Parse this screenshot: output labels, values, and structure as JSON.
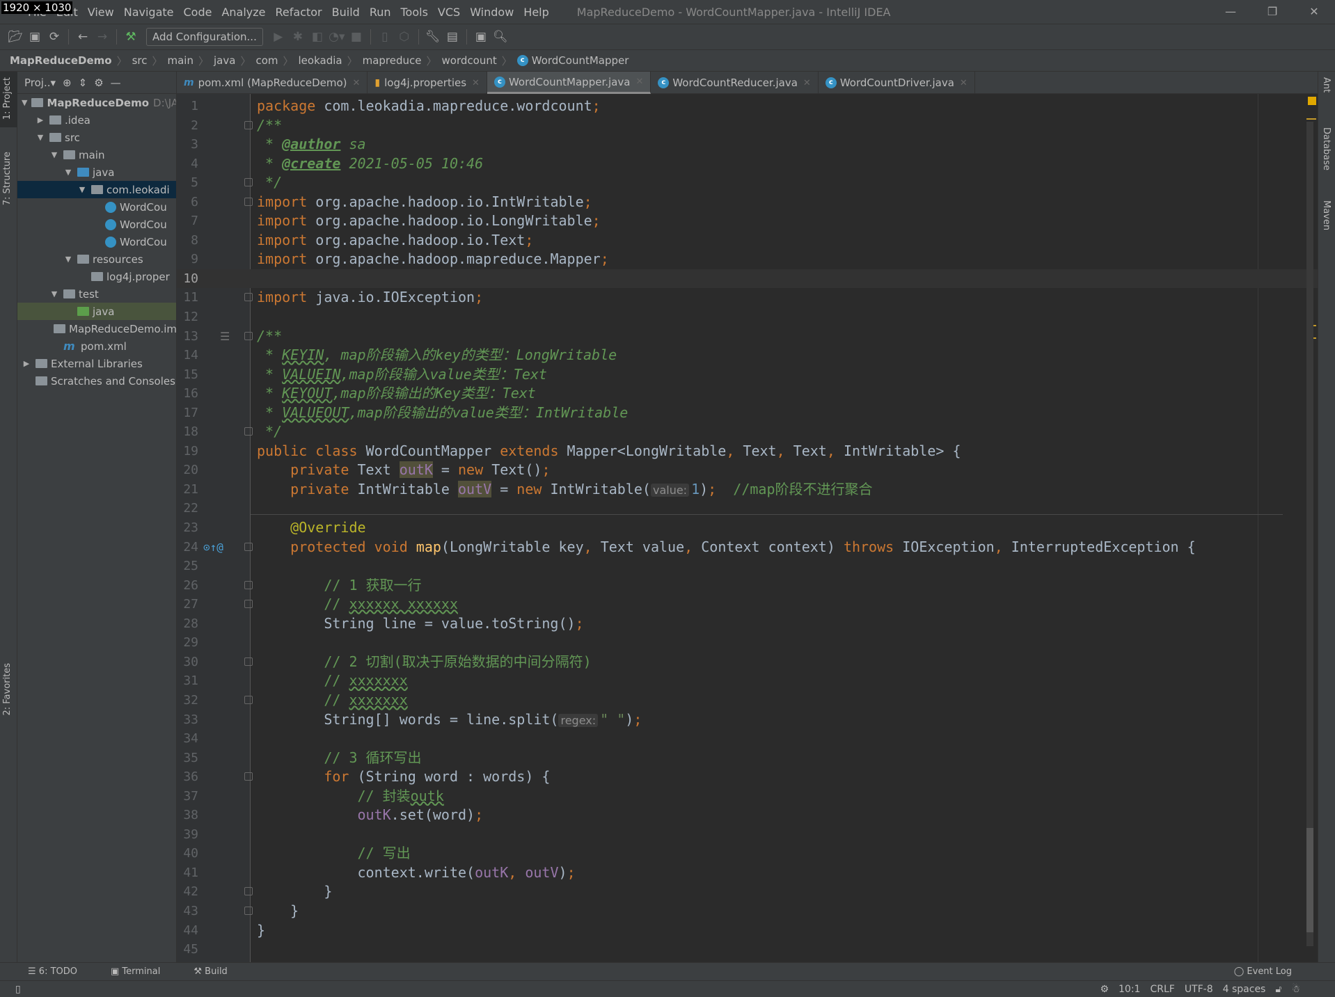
{
  "window": {
    "title": "MapReduceDemo - WordCountMapper.java - IntelliJ IDEA",
    "size_overlay": "1920 × 1030"
  },
  "menu": [
    "File",
    "Edit",
    "View",
    "Navigate",
    "Code",
    "Analyze",
    "Refactor",
    "Build",
    "Run",
    "Tools",
    "VCS",
    "Window",
    "Help"
  ],
  "toolbar": {
    "add_configuration": "Add Configuration..."
  },
  "breadcrumb": [
    "MapReduceDemo",
    "src",
    "main",
    "java",
    "com",
    "leokadia",
    "mapreduce",
    "wordcount",
    "WordCountMapper"
  ],
  "left_strip": {
    "project": "1: Project",
    "structure": "7: Structure",
    "favorites": "2: Favorites"
  },
  "right_strip": {
    "ant": "Ant",
    "database": "Database",
    "maven": "Maven"
  },
  "project": {
    "header": "Proj..▾",
    "tree": [
      {
        "label": "MapReduceDemo",
        "extra": "D:\\JA",
        "level": 0,
        "arrow": "▼",
        "icon": "module",
        "bold": true
      },
      {
        "label": ".idea",
        "level": 1,
        "arrow": "▶",
        "icon": "folder"
      },
      {
        "label": "src",
        "level": 1,
        "arrow": "▼",
        "icon": "folder"
      },
      {
        "label": "main",
        "level": 2,
        "arrow": "▼",
        "icon": "folder"
      },
      {
        "label": "java",
        "level": 3,
        "arrow": "▼",
        "icon": "folder-blue"
      },
      {
        "label": "com.leokadi",
        "level": 4,
        "arrow": "▼",
        "icon": "package",
        "selected": true
      },
      {
        "label": "WordCou",
        "level": 5,
        "arrow": "",
        "icon": "class"
      },
      {
        "label": "WordCou",
        "level": 5,
        "arrow": "",
        "icon": "class"
      },
      {
        "label": "WordCou",
        "level": 5,
        "arrow": "",
        "icon": "class"
      },
      {
        "label": "resources",
        "level": 3,
        "arrow": "▼",
        "icon": "folder"
      },
      {
        "label": "log4j.proper",
        "level": 4,
        "arrow": "",
        "icon": "properties"
      },
      {
        "label": "test",
        "level": 2,
        "arrow": "▼",
        "icon": "folder"
      },
      {
        "label": "java",
        "level": 3,
        "arrow": "",
        "icon": "folder-green",
        "highlight": true
      },
      {
        "label": "MapReduceDemo.iml",
        "level": 2,
        "arrow": "",
        "icon": "file"
      },
      {
        "label": "pom.xml",
        "level": 2,
        "arrow": "",
        "icon": "maven"
      },
      {
        "label": "External Libraries",
        "level": 0,
        "arrow": "▶",
        "icon": "libraries"
      },
      {
        "label": "Scratches and Consoles",
        "level": 0,
        "arrow": "",
        "icon": "scratches"
      }
    ]
  },
  "tabs": [
    {
      "label": "pom.xml (MapReduceDemo)",
      "icon": "m"
    },
    {
      "label": "log4j.properties",
      "icon": "▮"
    },
    {
      "label": "WordCountMapper.java",
      "icon": "c",
      "active": true
    },
    {
      "label": "WordCountReducer.java",
      "icon": "c"
    },
    {
      "label": "WordCountDriver.java",
      "icon": "c"
    }
  ],
  "editor": {
    "current_line": 10,
    "lines": [
      [
        [
          "kw",
          "package"
        ],
        [
          "pl",
          " com.leokadia.mapreduce.wordcount"
        ],
        [
          "kw",
          ";"
        ]
      ],
      [
        [
          "doc",
          "/**"
        ]
      ],
      [
        [
          "doc",
          " * "
        ],
        [
          "tag",
          "@author"
        ],
        [
          "doc",
          " sa"
        ]
      ],
      [
        [
          "doc",
          " * "
        ],
        [
          "tag",
          "@create"
        ],
        [
          "doc",
          " 2021-05-05 10:46"
        ]
      ],
      [
        [
          "doc",
          " */"
        ]
      ],
      [
        [
          "kw",
          "import"
        ],
        [
          "pl",
          " org.apache.hadoop.io.IntWritable"
        ],
        [
          "kw",
          ";"
        ]
      ],
      [
        [
          "kw",
          "import"
        ],
        [
          "pl",
          " org.apache.hadoop.io.LongWritable"
        ],
        [
          "kw",
          ";"
        ]
      ],
      [
        [
          "kw",
          "import"
        ],
        [
          "pl",
          " org.apache.hadoop.io.Text"
        ],
        [
          "kw",
          ";"
        ]
      ],
      [
        [
          "kw",
          "import"
        ],
        [
          "pl",
          " org.apache.hadoop.mapreduce.Mapper"
        ],
        [
          "kw",
          ";"
        ]
      ],
      [],
      [
        [
          "kw",
          "import"
        ],
        [
          "pl",
          " java.io.IOException"
        ],
        [
          "kw",
          ";"
        ]
      ],
      [],
      [
        [
          "doc",
          "/**"
        ]
      ],
      [
        [
          "doc",
          " * "
        ],
        [
          "docu",
          "KEYIN"
        ],
        [
          "doc",
          ", map阶段输入的key的类型：LongWritable"
        ]
      ],
      [
        [
          "doc",
          " * "
        ],
        [
          "docu",
          "VALUEIN"
        ],
        [
          "doc",
          ",map阶段输入value类型：Text"
        ]
      ],
      [
        [
          "doc",
          " * "
        ],
        [
          "docu",
          "KEYOUT"
        ],
        [
          "doc",
          ",map阶段输出的Key类型：Text"
        ]
      ],
      [
        [
          "doc",
          " * "
        ],
        [
          "docu",
          "VALUEOUT"
        ],
        [
          "doc",
          ",map阶段输出的value类型：IntWritable"
        ]
      ],
      [
        [
          "doc",
          " */"
        ]
      ],
      [
        [
          "kw",
          "public class "
        ],
        [
          "pl",
          "WordCountMapper "
        ],
        [
          "kw",
          "extends "
        ],
        [
          "pl",
          "Mapper<LongWritable"
        ],
        [
          "kw",
          ", "
        ],
        [
          "pl",
          "Text"
        ],
        [
          "kw",
          ", "
        ],
        [
          "pl",
          "Text"
        ],
        [
          "kw",
          ", "
        ],
        [
          "pl",
          "IntWritable> {"
        ]
      ],
      [
        [
          "pl",
          "    "
        ],
        [
          "kw",
          "private "
        ],
        [
          "pl",
          "Text "
        ],
        [
          "fldh",
          "outK"
        ],
        [
          "pl",
          " = "
        ],
        [
          "kw",
          "new "
        ],
        [
          "pl",
          "Text()"
        ],
        [
          "kw",
          ";"
        ]
      ],
      [
        [
          "pl",
          "    "
        ],
        [
          "kw",
          "private "
        ],
        [
          "pl",
          "IntWritable "
        ],
        [
          "fldh",
          "outV"
        ],
        [
          "pl",
          " = "
        ],
        [
          "kw",
          "new "
        ],
        [
          "pl",
          "IntWritable("
        ],
        [
          "hint",
          "value:"
        ],
        [
          "num",
          "1"
        ],
        [
          "pl",
          ")"
        ],
        [
          "kw",
          ";"
        ],
        [
          "pl",
          "  "
        ],
        [
          "cm",
          "//map阶段不进行聚合"
        ]
      ],
      [],
      [
        [
          "pl",
          "    "
        ],
        [
          "ann",
          "@Override"
        ]
      ],
      [
        [
          "pl",
          "    "
        ],
        [
          "kw",
          "protected void "
        ],
        [
          "fn",
          "map"
        ],
        [
          "pl",
          "(LongWritable key"
        ],
        [
          "kw",
          ", "
        ],
        [
          "pl",
          "Text value"
        ],
        [
          "kw",
          ", "
        ],
        [
          "pl",
          "Context context) "
        ],
        [
          "kw",
          "throws "
        ],
        [
          "pl",
          "IOException"
        ],
        [
          "kw",
          ", "
        ],
        [
          "pl",
          "InterruptedException {"
        ]
      ],
      [],
      [
        [
          "pl",
          "        "
        ],
        [
          "cm",
          "// 1 获取一行"
        ]
      ],
      [
        [
          "pl",
          "        "
        ],
        [
          "cm",
          "// "
        ],
        [
          "cmu",
          "xxxxxx xxxxxx"
        ]
      ],
      [
        [
          "pl",
          "        String line = value.toString()"
        ],
        [
          "kw",
          ";"
        ]
      ],
      [],
      [
        [
          "pl",
          "        "
        ],
        [
          "cm",
          "// 2 切割(取决于原始数据的中间分隔符)"
        ]
      ],
      [
        [
          "pl",
          "        "
        ],
        [
          "cm",
          "// "
        ],
        [
          "cmu",
          "xxxxxxx"
        ]
      ],
      [
        [
          "pl",
          "        "
        ],
        [
          "cm",
          "// "
        ],
        [
          "cmu",
          "xxxxxxx"
        ]
      ],
      [
        [
          "pl",
          "        String[] words = line.split("
        ],
        [
          "hint",
          "regex:"
        ],
        [
          "str",
          "\" \""
        ],
        [
          "pl",
          ")"
        ],
        [
          "kw",
          ";"
        ]
      ],
      [],
      [
        [
          "pl",
          "        "
        ],
        [
          "cm",
          "// 3 循环写出"
        ]
      ],
      [
        [
          "pl",
          "        "
        ],
        [
          "kw",
          "for "
        ],
        [
          "pl",
          "(String word : words) {"
        ]
      ],
      [
        [
          "pl",
          "            "
        ],
        [
          "cm",
          "// 封装"
        ],
        [
          "cmu",
          "outk"
        ]
      ],
      [
        [
          "pl",
          "            "
        ],
        [
          "fld",
          "outK"
        ],
        [
          "pl",
          ".set(word)"
        ],
        [
          "kw",
          ";"
        ]
      ],
      [],
      [
        [
          "pl",
          "            "
        ],
        [
          "cm",
          "// 写出"
        ]
      ],
      [
        [
          "pl",
          "            context.write("
        ],
        [
          "fld",
          "outK"
        ],
        [
          "kw",
          ", "
        ],
        [
          "fld",
          "outV"
        ],
        [
          "pl",
          ")"
        ],
        [
          "kw",
          ";"
        ]
      ],
      [
        [
          "pl",
          "        }"
        ]
      ],
      [
        [
          "pl",
          "    }"
        ]
      ],
      [
        [
          "pl",
          "}"
        ]
      ],
      []
    ]
  },
  "bottom_tools": {
    "todo": "6: TODO",
    "terminal": "Terminal",
    "build": "Build",
    "event_log": "Event Log"
  },
  "status": {
    "position": "10:1",
    "line_sep": "CRLF",
    "encoding": "UTF-8",
    "indent": "4 spaces"
  },
  "colors": {
    "keyword": "#cc7832",
    "doc_comment": "#629755",
    "field": "#9876aa",
    "annotation": "#bbb529",
    "method": "#ffc66d",
    "string": "#6a8759",
    "number": "#6897bb"
  }
}
